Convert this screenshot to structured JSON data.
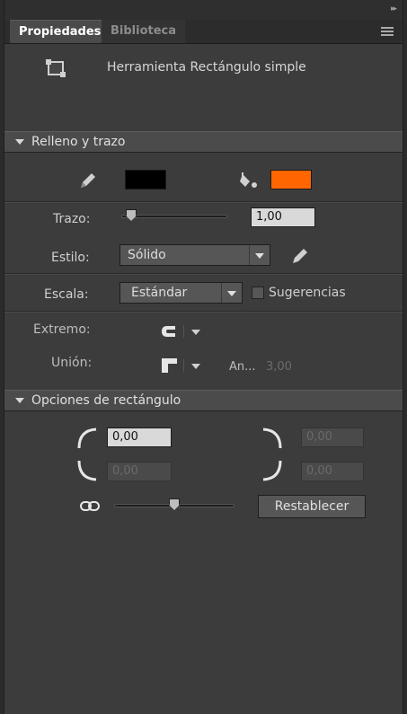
{
  "tabs": [
    {
      "label": "Propiedades",
      "active": true
    },
    {
      "label": "Biblioteca",
      "active": false
    }
  ],
  "tool": {
    "name": "Herramienta Rectángulo simple",
    "icon": "rectangle-tool-icon"
  },
  "fill_stroke": {
    "title": "Relleno y trazo",
    "stroke_color": "#000000",
    "fill_color": "#ff6600",
    "stroke_label": "Trazo:",
    "stroke_value": "1,00",
    "stroke_slider": 0.05,
    "style_label": "Estilo:",
    "style_value": "Sólido",
    "scale_label": "Escala:",
    "scale_value": "Estándar",
    "hints_label": "Sugerencias",
    "cap_label": "Extremo:",
    "join_label": "Unión:",
    "miter_label": "An...",
    "miter_value": "3,00"
  },
  "rect_options": {
    "title": "Opciones de rectángulo",
    "corner_tl": "0,00",
    "corner_tr": "0,00",
    "corner_bl": "0,00",
    "corner_br": "0,00",
    "slider": 0.5,
    "reset_label": "Restablecer"
  }
}
